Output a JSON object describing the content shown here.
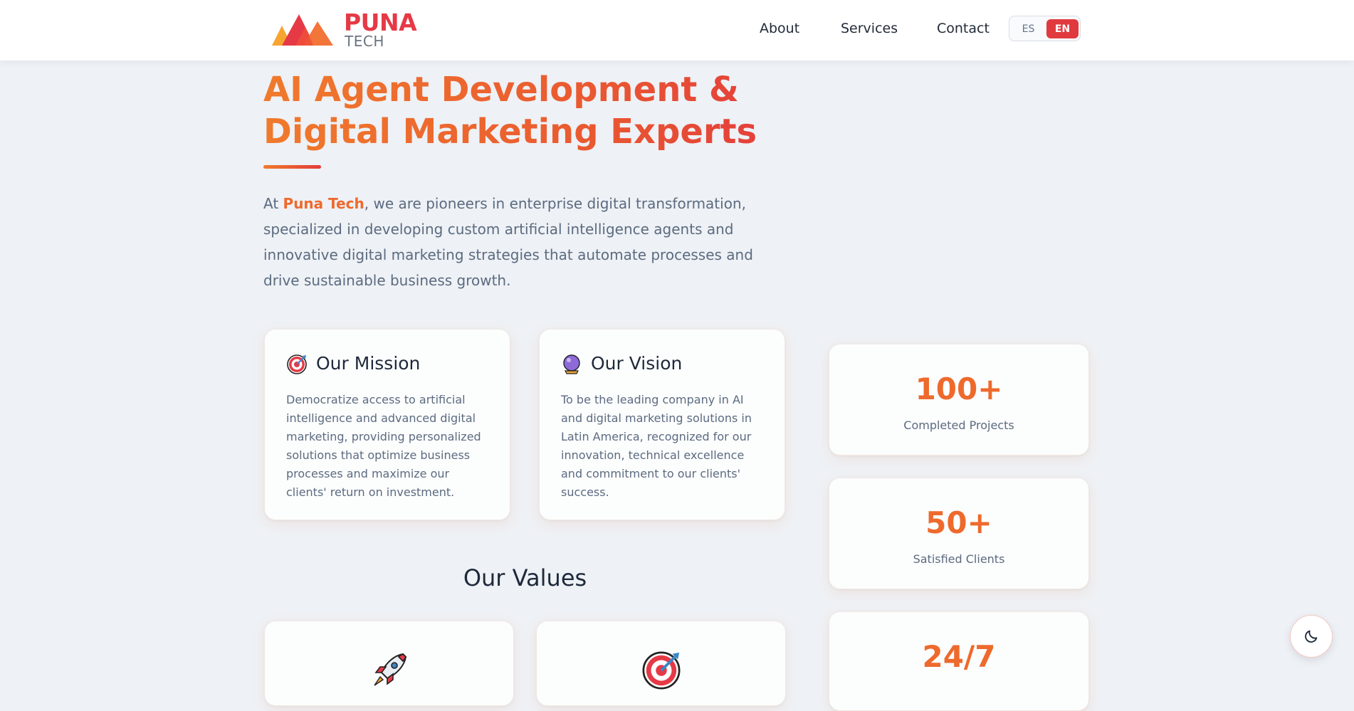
{
  "header": {
    "logo": {
      "name": "PUNA",
      "sub": "TECH"
    },
    "nav": [
      {
        "label": "About"
      },
      {
        "label": "Services"
      },
      {
        "label": "Contact"
      }
    ],
    "language": {
      "options": [
        "ES",
        "EN"
      ],
      "selected": "EN"
    }
  },
  "hero": {
    "title": "AI Agent Development & Digital Marketing Experts",
    "desc_prefix": "At ",
    "desc_brand": "Puna Tech",
    "desc_rest": ", we are pioneers in enterprise digital transformation, specialized in developing custom artificial intelligence agents and innovative digital marketing strategies that automate processes and drive sustainable business growth."
  },
  "mission": {
    "icon": "target-icon",
    "title": "Our Mission",
    "text": "Democratize access to artificial intelligence and advanced digital marketing, providing personalized solutions that optimize business processes and maximize our clients' return on investment."
  },
  "vision": {
    "icon": "crystal-ball-icon",
    "title": "Our Vision",
    "text": "To be the leading company in AI and digital marketing solutions in Latin America, recognized for our innovation, technical excellence and commitment to our clients' success."
  },
  "values": {
    "heading": "Our Values",
    "cards": [
      {
        "icon": "rocket-icon"
      },
      {
        "icon": "target-icon"
      }
    ]
  },
  "stats": [
    {
      "number": "100+",
      "label": "Completed Projects"
    },
    {
      "number": "50+",
      "label": "Satisfied Clients"
    },
    {
      "number": "24/7",
      "label": ""
    }
  ],
  "theme_toggle": {
    "icon": "moon-icon"
  },
  "colors": {
    "accent_orange": "#ee6a2c",
    "accent_red": "#e03a3e",
    "background": "#eef1f5"
  }
}
